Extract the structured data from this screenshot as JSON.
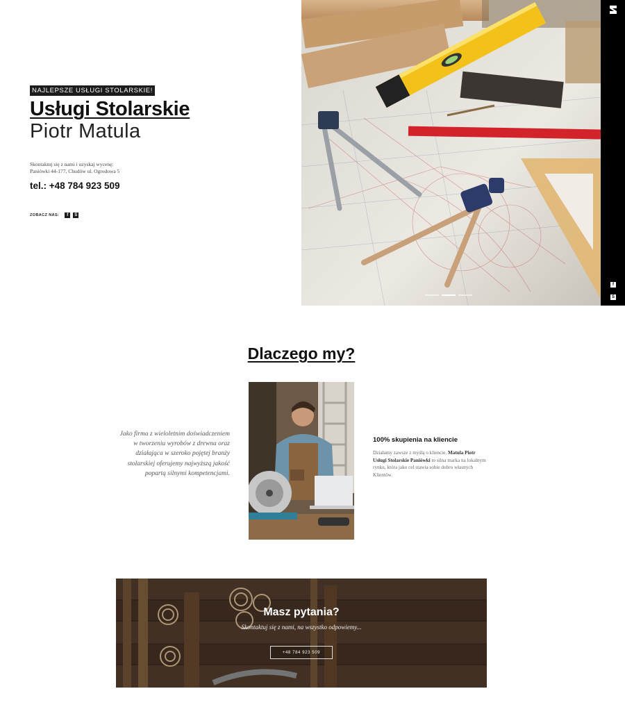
{
  "hero": {
    "tagline": "NAJLEPSZE USŁUGI STOLARSKIE!",
    "title": "Usługi Stolarskie",
    "subtitle": "Piotr Matula",
    "contact_intro": "Skontaktuj się z nami i uzyskaj wycenę:",
    "address": "Paniówki 44-177, Chudów ul. Ogrodowa 5",
    "phone": "tel.: +48 784 923 509",
    "social_label": "ZOBACZ NAS:",
    "social_icons": [
      "facebook-icon",
      "skype-icon"
    ],
    "slider": {
      "slides": 3,
      "active": 2
    }
  },
  "side_bar": {
    "icons": [
      "brand-logo",
      "facebook-icon",
      "skype-icon"
    ]
  },
  "why": {
    "heading": "Dlaczego my?",
    "left_text": "Jako firma z wieloletnim doświadczeniem w tworzeniu wyrobów z drewna oraz działająca w szeroko pojętej branży stolarskiej oferujemy najwyższą jakość popartą silnymi kompetencjami.",
    "right_title": "100% skupienia na kliencie",
    "right_text_1": "Działamy zawsze z myślą o kliencie. ",
    "right_text_bold": "Matula Piotr Usługi Stolarskie Paniówki",
    "right_text_2": " to silna marka na lokalnym rynku, która jako cel stawia sobie dobro własnych Klientów."
  },
  "cta": {
    "title": "Masz pytania?",
    "text": "Skontaktuj się z nami, na wszystko odpowiemy...",
    "button": "+48 784 923 509"
  },
  "colors": {
    "dark": "#1c1c1c",
    "level_yellow": "#f2c21b",
    "pencil_red": "#d2232a",
    "wood": "#6b4a2e"
  }
}
